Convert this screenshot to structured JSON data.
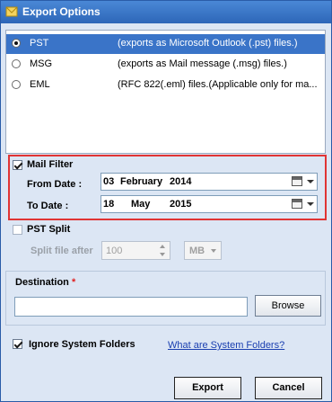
{
  "window": {
    "title": "Export Options"
  },
  "formats": [
    {
      "name": "PST",
      "desc": "(exports as Microsoft Outlook (.pst) files.)",
      "selected": true
    },
    {
      "name": "MSG",
      "desc": "(exports as Mail message (.msg) files.)",
      "selected": false
    },
    {
      "name": "EML",
      "desc": "(RFC 822(.eml) files.(Applicable only for ma...",
      "selected": false
    }
  ],
  "mail_filter": {
    "label": "Mail Filter",
    "checked": true,
    "from_label": "From Date :",
    "from_day": "03",
    "from_month": "February",
    "from_year": "2014",
    "to_label": "To Date :",
    "to_day": "18",
    "to_month": "May",
    "to_year": "2015"
  },
  "pst_split": {
    "label": "PST Split",
    "checked": false,
    "split_label": "Split file after",
    "value": "100",
    "unit": "MB"
  },
  "destination": {
    "label": "Destination",
    "required_mark": "*",
    "value": "",
    "browse_label": "Browse"
  },
  "ignore_system": {
    "label": "Ignore System Folders",
    "checked": true,
    "link": "What are System Folders?"
  },
  "buttons": {
    "export": "Export",
    "cancel": "Cancel"
  },
  "colors": {
    "title_bar": "#2d66b8",
    "selection": "#3a74c8",
    "highlight_border": "#e03434",
    "background": "#dce6f4"
  }
}
